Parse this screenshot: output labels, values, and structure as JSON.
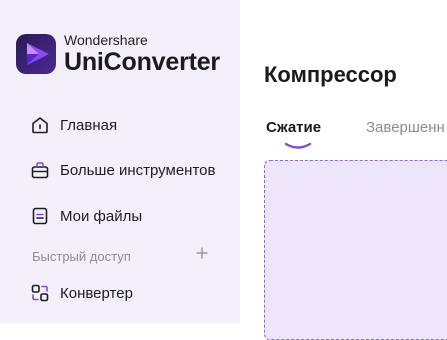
{
  "sidebar": {
    "brand": {
      "company": "Wondershare",
      "product": "UniConverter"
    },
    "items": [
      {
        "label": "Главная",
        "icon": "home-icon"
      },
      {
        "label": "Больше инструментов",
        "icon": "toolbox-icon"
      },
      {
        "label": "Мои файлы",
        "icon": "file-icon"
      }
    ],
    "quick_access": {
      "label": "Быстрый доступ",
      "add_icon": "plus-icon"
    },
    "quick_items": [
      {
        "label": "Конвертер",
        "icon": "converter-icon"
      }
    ]
  },
  "main": {
    "title": "Компрессор",
    "tabs": [
      {
        "label": "Сжатие",
        "active": true
      },
      {
        "label": "Завершенн",
        "active": false
      }
    ]
  },
  "colors": {
    "sidebar_bg": "#f3f0fb",
    "accent": "#7b4fd6",
    "drop_zone_bg": "#ede6fb",
    "drop_zone_border": "#8c6cc4"
  }
}
